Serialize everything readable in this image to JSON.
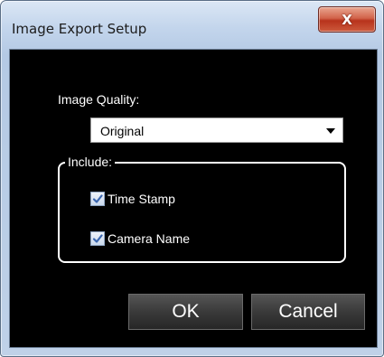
{
  "window": {
    "title": "Image Export Setup",
    "close_glyph": "X"
  },
  "image_quality": {
    "label": "Image Quality:",
    "selected": "Original"
  },
  "include": {
    "legend": "Include:",
    "options": [
      {
        "label": "Time Stamp",
        "checked": true
      },
      {
        "label": "Camera Name",
        "checked": true
      }
    ]
  },
  "buttons": {
    "ok_label": "OK",
    "cancel_label": "Cancel"
  },
  "colors": {
    "client_bg": "#000000",
    "close_button": "#c2402a",
    "frame": "#bfd1e8",
    "check_mark": "#3a66b0"
  },
  "icons": {
    "close": "close-icon",
    "dropdown": "chevron-down-icon",
    "checkbox": "checkmark-icon"
  }
}
